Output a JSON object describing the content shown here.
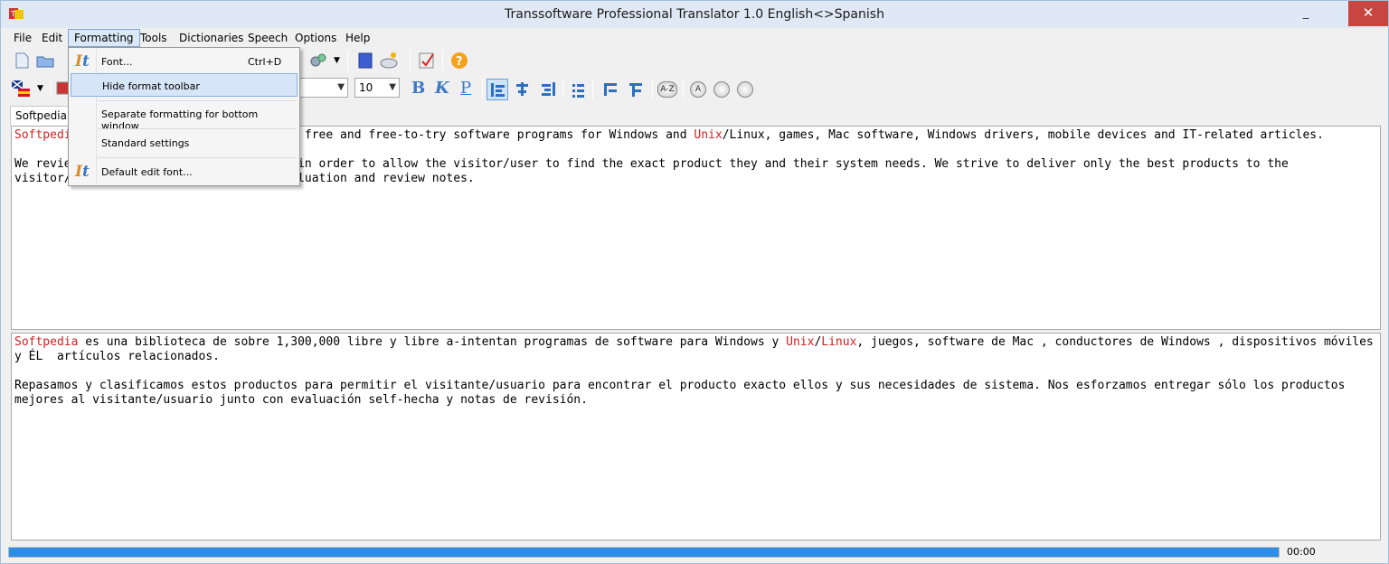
{
  "window": {
    "title": "Transsoftware Professional Translator 1.0 English<>Spanish",
    "minimize_glyph": "_",
    "close_glyph": "✕"
  },
  "menu": {
    "items": [
      "File",
      "Edit",
      "Formatting",
      "Tools",
      "Dictionaries",
      "Speech",
      "Options",
      "Help"
    ],
    "active": "Formatting"
  },
  "formatting_menu": {
    "items": [
      {
        "label": "Font...",
        "shortcut": "Ctrl+D",
        "icon": "font-icon"
      },
      {
        "label": "Hide format toolbar",
        "shortcut": "",
        "icon": ""
      },
      {
        "label": "Separate formatting for bottom window",
        "shortcut": "",
        "icon": ""
      },
      {
        "label": "Standard settings",
        "shortcut": "",
        "icon": ""
      },
      {
        "label": "Default edit font...",
        "shortcut": "",
        "icon": "font-icon"
      }
    ],
    "highlighted": "Hide format toolbar"
  },
  "format_toolbar": {
    "font_size": "10",
    "bold_glyph": "B",
    "italic_glyph": "K",
    "underline_glyph": "P",
    "sort_glyph": "A-Z",
    "circle_glyph": "A"
  },
  "document": {
    "tab_label": "Softpedia.rt",
    "source_text": [
      {
        "parts": [
          {
            "text": "Softpedia",
            "red": true
          },
          {
            "text": " is a library of over 1,300,000 free and free-to-try software programs for Windows and ",
            "red": false
          },
          {
            "text": "Unix",
            "red": true
          },
          {
            "text": "/Linux, games, Mac software, Windows drivers, mobile devices and IT-related articles.",
            "red": false
          }
        ]
      },
      {
        "parts": [
          {
            "text": "We review and categorize these products in order to allow the visitor/user to find the exact product they and their system needs. We strive to deliver only the best products to the visitor/user together with self-made evaluation and review notes.",
            "red": false
          }
        ]
      }
    ],
    "target_text": [
      {
        "parts": [
          {
            "text": "Softpedia",
            "red": true
          },
          {
            "text": " es una biblioteca de sobre 1,300,000 libre y libre a-intentan programas de software para Windows y ",
            "red": false
          },
          {
            "text": "Unix",
            "red": true
          },
          {
            "text": "/",
            "red": false
          },
          {
            "text": "Linux",
            "red": true
          },
          {
            "text": ", juegos, software de Mac , conductores de Windows , dispositivos móviles y ÉL  artículos relacionados.",
            "red": false
          }
        ]
      },
      {
        "parts": [
          {
            "text": "Repasamos y clasificamos estos productos para permitir el visitante/usuario para encontrar el producto exacto ellos y sus necesidades de sistema. Nos esforzamos entregar sólo los productos mejores al visitante/usuario junto con evaluación self-hecha y notas de revisión.",
            "red": false
          }
        ]
      }
    ]
  },
  "status": {
    "progress": 1.0,
    "time": "00:00"
  }
}
